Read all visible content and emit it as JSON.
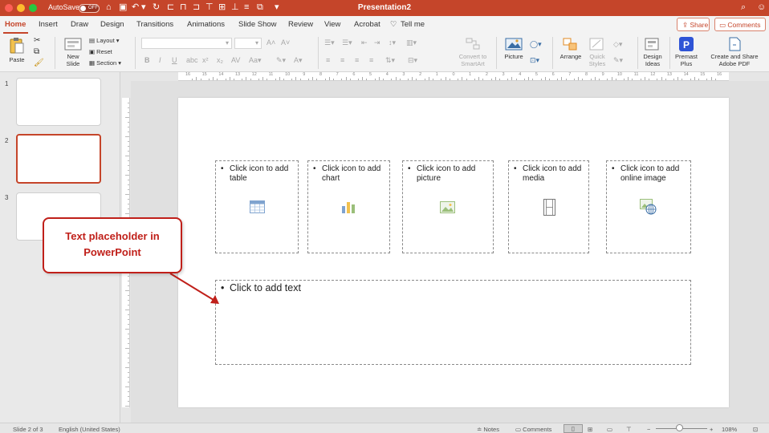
{
  "titlebar": {
    "autosave_label": "AutoSave",
    "autosave_state": "OFF",
    "title": "Presentation2"
  },
  "tabs": [
    "Home",
    "Insert",
    "Draw",
    "Design",
    "Transitions",
    "Animations",
    "Slide Show",
    "Review",
    "View",
    "Acrobat",
    "Tell me"
  ],
  "active_tab": "Home",
  "share_label": "Share",
  "comments_label": "Comments",
  "ribbon": {
    "paste": "Paste",
    "new_slide_1": "New",
    "new_slide_2": "Slide",
    "layout": "Layout",
    "reset": "Reset",
    "section": "Section",
    "convert_1": "Convert to",
    "convert_2": "SmartArt",
    "picture": "Picture",
    "arrange": "Arrange",
    "quick_styles_1": "Quick",
    "quick_styles_2": "Styles",
    "design_ideas_1": "Design",
    "design_ideas_2": "Ideas",
    "premast_1": "Premast",
    "premast_2": "Plus",
    "adobe_1": "Create and Share",
    "adobe_2": "Adobe PDF"
  },
  "ruler_labels": [
    "16",
    "15",
    "14",
    "13",
    "12",
    "11",
    "10",
    "9",
    "8",
    "7",
    "6",
    "5",
    "4",
    "3",
    "2",
    "1",
    "0",
    "1",
    "2",
    "3",
    "4",
    "5",
    "6",
    "7",
    "8",
    "9",
    "10",
    "11",
    "12",
    "13",
    "14",
    "15",
    "16"
  ],
  "thumbnails": [
    {
      "num": "1",
      "selected": false
    },
    {
      "num": "2",
      "selected": true
    },
    {
      "num": "3",
      "selected": false
    }
  ],
  "placeholders": [
    {
      "line1": "Click icon to add",
      "line2": "table",
      "icon": "table-icon"
    },
    {
      "line1": "Click icon to add",
      "line2": "chart",
      "icon": "chart-icon"
    },
    {
      "line1": "Click icon to add",
      "line2": "picture",
      "icon": "picture-icon"
    },
    {
      "line1": "Click icon to add",
      "line2": "media",
      "icon": "media-icon"
    },
    {
      "line1": "Click icon to add",
      "line2": "online image",
      "icon": "online-image-icon"
    }
  ],
  "body_placeholder": "Click to add text",
  "bullet": "•",
  "callout": {
    "line1": "Text placeholder in",
    "line2": "PowerPoint"
  },
  "status": {
    "slide_info": "Slide 2 of 3",
    "language": "English (United States)",
    "notes": "Notes",
    "comments": "Comments",
    "zoom": "108%"
  },
  "colors": {
    "accent": "#c5452a",
    "callout": "#c0201a"
  }
}
